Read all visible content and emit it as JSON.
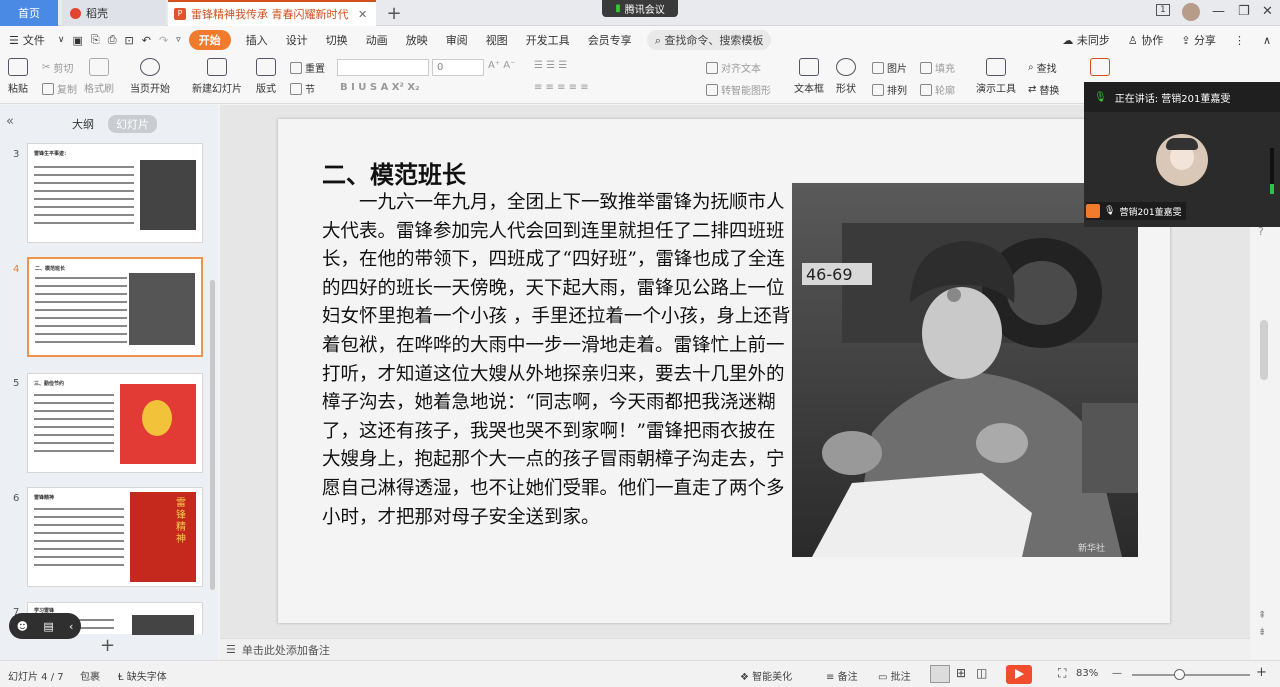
{
  "titlebar": {
    "home_tab": "首页",
    "doke_tab": "稻壳",
    "doc_tab": "雷锋精神我传承 青春闪耀新时代",
    "meeting_pill": "腾讯会议",
    "window_badge": "1"
  },
  "menu": {
    "file": "文件",
    "items": [
      "开始",
      "插入",
      "设计",
      "切换",
      "动画",
      "放映",
      "审阅",
      "视图",
      "开发工具",
      "会员专享"
    ],
    "search": "查找命令、搜索模板",
    "sync": "未同步",
    "collab": "协作",
    "share": "分享"
  },
  "ribbon": {
    "paste": "粘贴",
    "cut": "剪切",
    "copy": "复制",
    "format_painter": "格式刷",
    "from_current": "当页开始",
    "new_slide": "新建幻灯片",
    "layout": "版式",
    "section": "节",
    "reset": "重置",
    "font_size": "0",
    "align_text": "对齐文本",
    "smart_shape": "转智能图形",
    "textbox": "文本框",
    "shape": "形状",
    "picture": "图片",
    "fill": "填充",
    "arrange": "排列",
    "outline": "轮廓",
    "presentation_tools": "演示工具",
    "find": "查找",
    "replace": "替换"
  },
  "leftpanel": {
    "tab_outline": "大纲",
    "tab_slides": "幻灯片",
    "slide_numbers": [
      "3",
      "4",
      "5",
      "6",
      "7"
    ],
    "thumb3_title": "雷锋生平事迹：",
    "thumb4_title": "二、模范班长",
    "thumb5_title": "三、勤俭节约",
    "thumb6_title": "雷锋精神",
    "thumb6_banner": "雷锋精神",
    "thumb7_title": "学习雷锋"
  },
  "slide": {
    "title": "二、模范班长",
    "body": "一九六一年九月，全团上下一致推举雷锋为抚顺市人大代表。雷锋参加完人代会回到连里就担任了二排四班班长，在他的带领下，四班成了“四好班”，雷锋也成了全连的四好的班长一天傍晚，天下起大雨，雷锋见公路上一位妇女怀里抱着一个小孩 ，手里还拉着一个小孩，身上还背着包袱，在哗哗的大雨中一步一滑地走着。雷锋忙上前一打听，才知道这位大嫂从外地探亲归来，要去十几里外的樟子沟去，她着急地说：“同志啊，今天雨都把我浇迷糊了，这还有孩子，我哭也哭不到家啊！”雷锋把雨衣披在大嫂身上，抱起那个大一点的孩子冒雨朝樟子沟走去，宁愿自己淋得透湿，也不让她们受罪。他们一直走了两个多小时，才把那对母子安全送到家。",
    "photo_plate": "46-69",
    "photo_watermark": "新华社"
  },
  "notes": {
    "placeholder": "单击此处添加备注"
  },
  "meeting": {
    "speaking": "正在讲话: 营销201董嘉雯",
    "name": "营销201董嘉雯"
  },
  "status": {
    "slide_info": "幻灯片 4 / 7",
    "theme": "包裹",
    "missing_font": "缺失字体",
    "beautify": "智能美化",
    "notes": "备注",
    "comments": "批注",
    "zoom": "83%"
  },
  "colors": {
    "accent": "#f07b2c",
    "home_tab": "#4a8ae4",
    "play": "#f04c2d"
  }
}
